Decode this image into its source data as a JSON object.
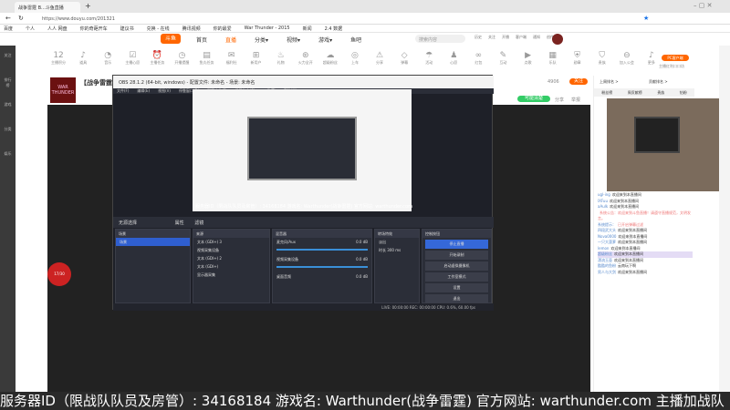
{
  "browser": {
    "tab_title": "战争雷霆 B...斗鱼直播",
    "url": "https://www.douyu.com/201321",
    "bookmarks": [
      "百度",
      "个人",
      "人人 网盘",
      "你的奇葩开车",
      "建议书",
      "兑换 - 在线",
      "腾讯视频",
      "你的最爱",
      "War Thunder - 2015",
      "新闻",
      "2.4 数据"
    ]
  },
  "header": {
    "logo": "斗鱼",
    "nav": [
      "首页",
      "直播",
      "分类▾",
      "视频▾",
      "游戏▾",
      "鱼吧"
    ],
    "search_placeholder": "搜索内容",
    "icons": [
      "历史",
      "关注",
      "开播",
      "客户端",
      "通知",
      "创作中心"
    ]
  },
  "sidebar": [
    "关注",
    "排行榜",
    "游戏",
    "分类",
    "娱乐"
  ],
  "iconrow": {
    "count": "12",
    "items": [
      "主播积分",
      "道具",
      "音乐",
      "主播心愿",
      "主播任务",
      "开播提醒",
      "鱼丸任务",
      "福利社",
      "新用户",
      "礼物",
      "火力全开",
      "超级粉丝",
      "上车",
      "分享",
      "弹幕",
      "活动",
      "心愿",
      "红包",
      "互动",
      "点歌",
      "乐队",
      "勋章",
      "贵族",
      "加入公会",
      "更多"
    ],
    "pc_button": "PC客户端",
    "pc_sub": "主播红利口口坊"
  },
  "room": {
    "title": "【战争雷霆】B...",
    "follow": "关注",
    "follow_count": "4906",
    "badge": "可能清楚",
    "share": "分享",
    "report": "举报"
  },
  "obs": {
    "title": "OBS 28.1.2 (64-bit, windows) - 配置文件: 未命名 - 场景: 未命名",
    "menu": [
      "文件(F)",
      "编辑(E)",
      "视图(V)",
      "停靠窗口(D)",
      "配置文件(P)",
      "场景集合(S)",
      "工具(T)",
      "帮助(H)"
    ],
    "overlay": "服务器ID（限战队队员及房管）: 34168184 游戏名: Warthunder(战争雷霆) 官方网站: warthunder.com",
    "source_bar": "无源选择",
    "props": "属性",
    "filters": "滤镜",
    "docks": {
      "scenes": "场景",
      "sources": "来源",
      "mixer": "混音器",
      "transitions": "转场特效",
      "controls": "控制按钮"
    },
    "scene_items": [
      "场景"
    ],
    "source_items": [
      "文本 (GDI+) 3",
      "视频采集设备",
      "文本 (GDI+) 2",
      "文本 (GDI+)",
      "显示器采集"
    ],
    "mixer_items": [
      {
        "name": "麦克风/Aux",
        "db": "0.0 dB"
      },
      {
        "name": "视频采集设备",
        "db": "0.0 dB"
      },
      {
        "name": "桌面音频",
        "db": "0.0 dB"
      }
    ],
    "transition": "淡出",
    "duration_label": "时长",
    "duration": "300 ms",
    "controls": [
      "停止直播",
      "开始录制",
      "启动虚拟摄像机",
      "工作室模式",
      "设置",
      "退出"
    ],
    "status": "LIVE: 00:00:00   REC: 00:00:00   CPU: 0.6%, 60.00 fps"
  },
  "right": {
    "rank": "上周排名 >",
    "gift": "贡献排名 >",
    "tabs": [
      "粉丝榜",
      "周贡献榜",
      "贵族",
      "钻粉"
    ],
    "chat": [
      {
        "u": "ugl-ing",
        "m": "欢迎来到本直播间"
      },
      {
        "u": "lXFuu",
        "m": "欢迎来到本直播间"
      },
      {
        "u": "aAulk",
        "m": "欢迎来到本直播间"
      },
      {
        "u": "",
        "m": "系统公告：欢迎来到斗鱼直播！请遵守直播规范，文明发言。",
        "sys": true
      },
      {
        "u": "系统提示：",
        "m": "已开启弹幕过滤",
        "sys": true
      },
      {
        "u": "四段武大头",
        "m": "欢迎来到本直播间"
      },
      {
        "u": "Nova0000",
        "m": "欢迎来到本直播间"
      },
      {
        "u": "一只大菠萝",
        "m": "欢迎来到本直播间"
      },
      {
        "u": "lemon",
        "m": "欢迎来到本直播间"
      },
      {
        "u": "超级粉丝",
        "m": "欢迎来到本直播间",
        "hl": true
      },
      {
        "u": "漂流玉壶",
        "m": "欢迎来到本直播间"
      },
      {
        "u": "酷酷的鱼粉",
        "m": "云南玩下啊"
      },
      {
        "u": "男人与大剑",
        "m": "欢迎来到本直播间"
      }
    ]
  },
  "badge_level": "17/30",
  "ticker": "服务器ID（限战队队员及房管）: 34168184 游戏名: Warthunder(战争雷霆) 官方网站: warthunder.com 主播加战队"
}
